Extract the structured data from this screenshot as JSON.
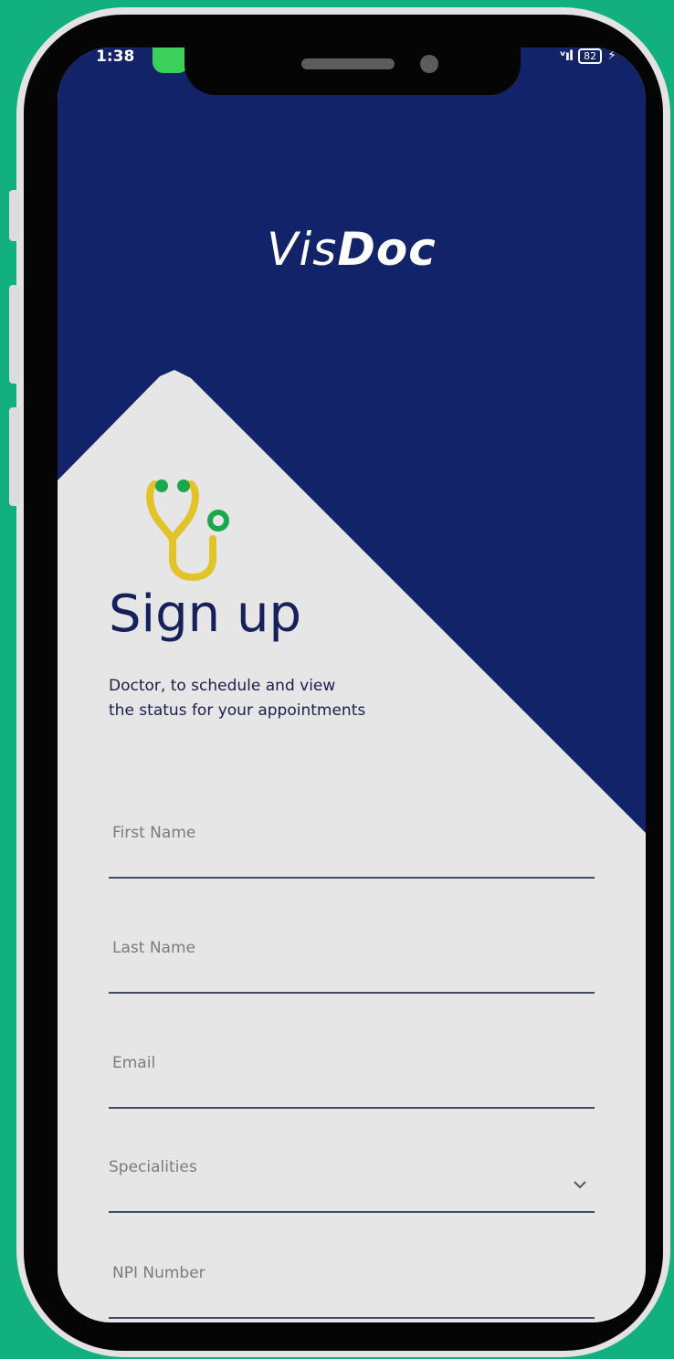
{
  "status_bar": {
    "time": "1:38",
    "signal": "ᵛıl",
    "battery": "82"
  },
  "app": {
    "logo_part1": "Vis",
    "logo_part2": "Doc"
  },
  "signup": {
    "title": "Sign up",
    "subtitle_line1": "Doctor, to schedule and view",
    "subtitle_line2": "the status for your appointments"
  },
  "form": {
    "first_name": "First Name",
    "last_name": "Last Name",
    "email": "Email",
    "specialities": "Specialities",
    "npi_number": "NPI Number"
  },
  "colors": {
    "background": "#12b07e",
    "header_navy": "#12236a",
    "screen_light": "#e6e6e6",
    "stethoscope_yellow": "#e2c42a",
    "stethoscope_green": "#1ba84a"
  },
  "icons": {
    "logo_icon": "stethoscope-icon",
    "dropdown_icon": "chevron-down-icon"
  }
}
